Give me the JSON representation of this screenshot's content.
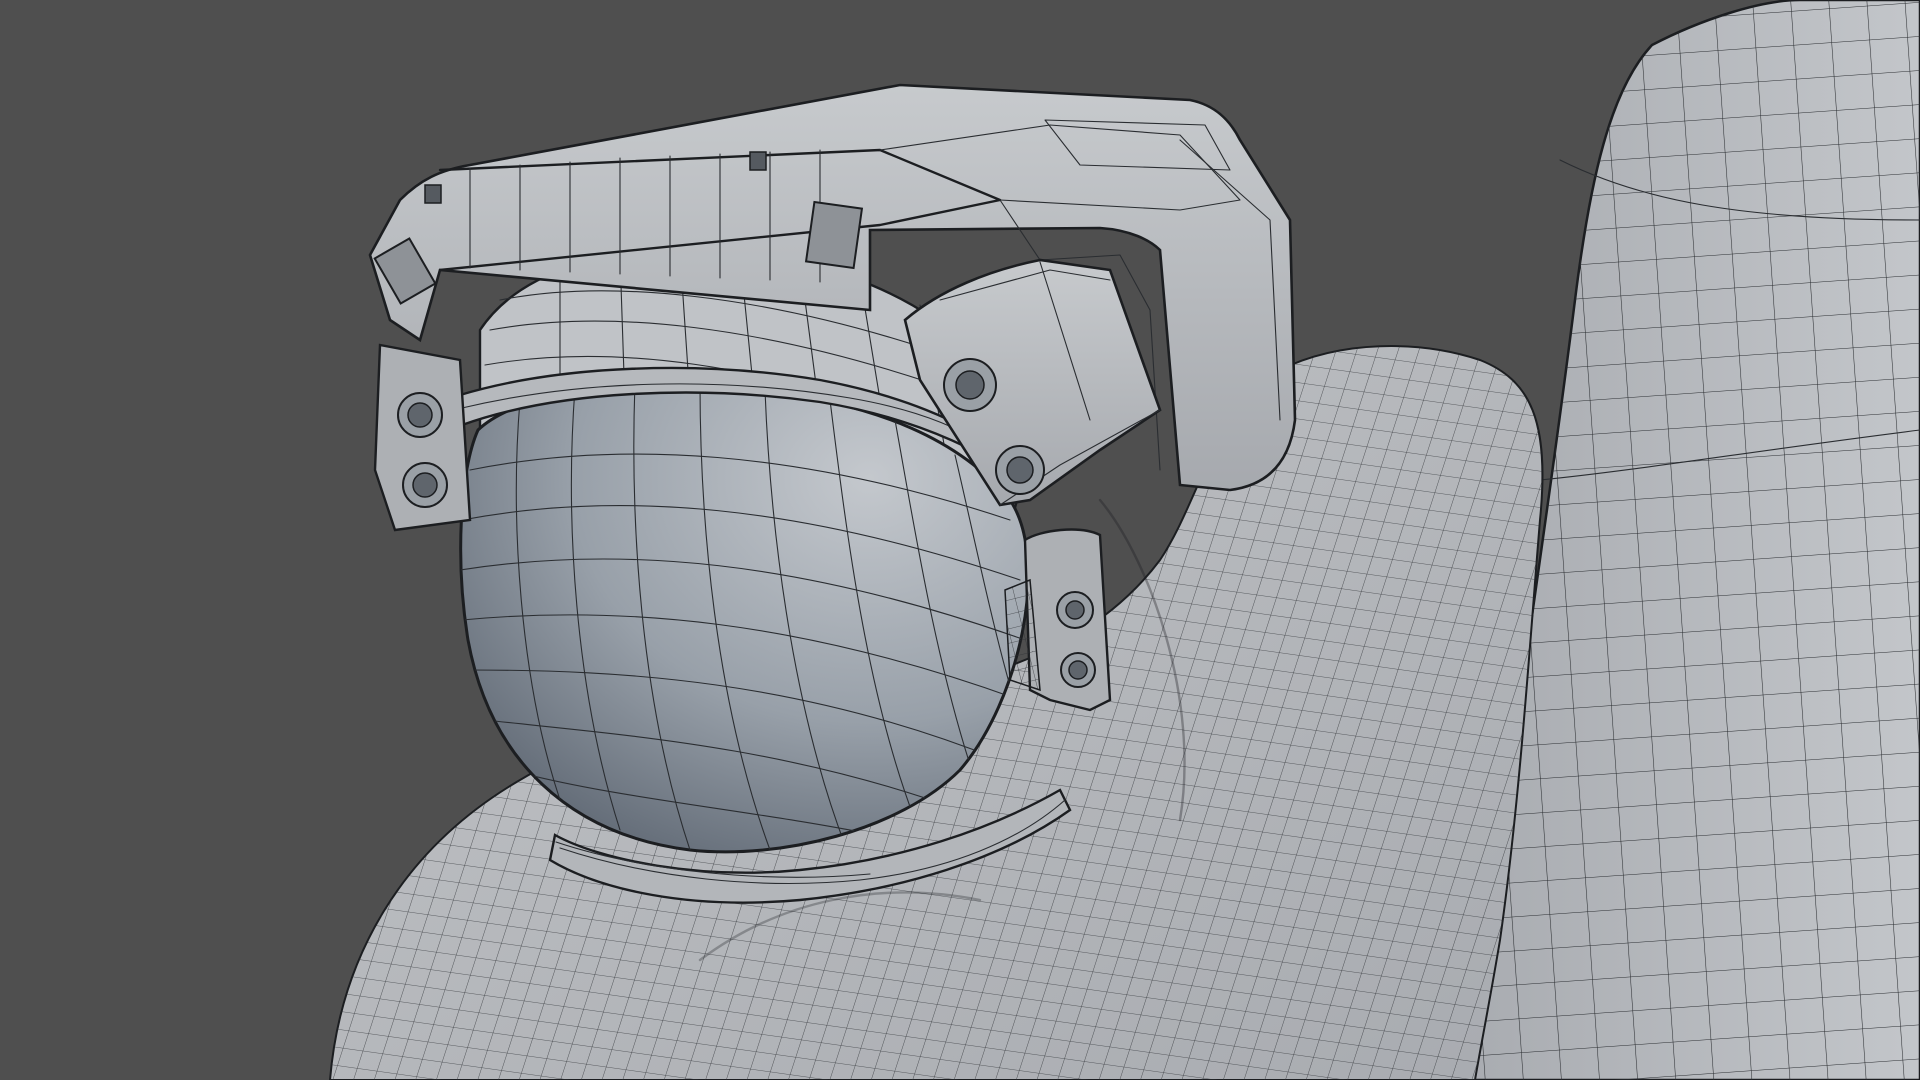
{
  "viewport": {
    "background_color": "#4f4f4f",
    "shading": "wireframe-over-solid",
    "mesh_surface_color": "#b9bcc0",
    "visor_color": "#7d8590",
    "wire_color": "#2a2d31"
  },
  "objects": [
    {
      "name": "helmet-dome"
    },
    {
      "name": "helmet-visor"
    },
    {
      "name": "helmet-rim"
    },
    {
      "name": "top-light-housing"
    },
    {
      "name": "side-camera-left"
    },
    {
      "name": "side-camera-right"
    },
    {
      "name": "lower-camera-right"
    },
    {
      "name": "neck-ring"
    },
    {
      "name": "suit-torso-cloth"
    },
    {
      "name": "backpack-panel"
    }
  ]
}
